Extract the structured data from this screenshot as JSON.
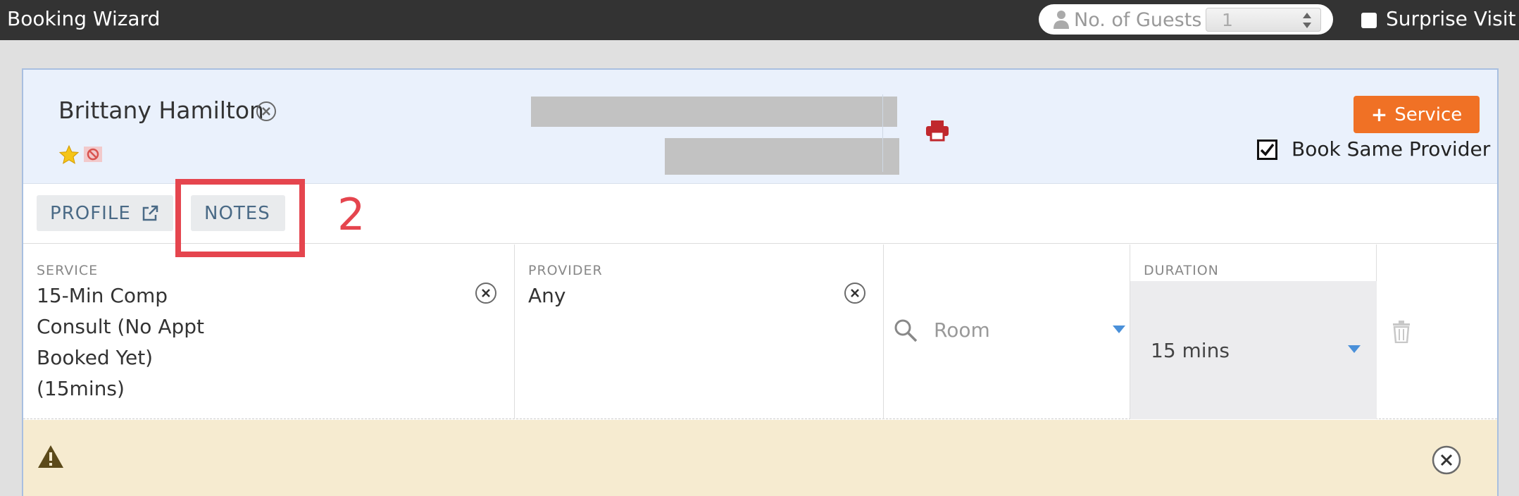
{
  "app": {
    "title": "Booking Wizard"
  },
  "topbar": {
    "guests_label": "No. of Guests",
    "guests_value": "1",
    "surprise_label": "Surprise Visit",
    "surprise_checked": false
  },
  "client": {
    "name": "Brittany Hamilton"
  },
  "actions": {
    "service_button": "Service",
    "book_same_provider": "Book Same Provider",
    "book_same_provider_checked": true
  },
  "tabs": [
    {
      "label": "PROFILE"
    },
    {
      "label": "NOTES"
    }
  ],
  "annotation": {
    "number": "2"
  },
  "service_row": {
    "service_label": "SERVICE",
    "service_lines": [
      "15-Min Comp",
      "Consult (No Appt",
      "Booked Yet)",
      "(15mins)"
    ],
    "provider_label": "PROVIDER",
    "provider_value": "Any",
    "room_placeholder": "Room",
    "duration_label": "DURATION",
    "duration_value": "15 mins"
  },
  "colors": {
    "topbar": "#333333",
    "accent_orange": "#f07125",
    "header_bg": "#eaf1fc",
    "annotation_red": "#e5454e",
    "warning_bg": "#f6ebd0",
    "print_red": "#c0282d"
  },
  "icons": {
    "user": "user-icon",
    "remove": "close-circle-icon",
    "star": "star-icon",
    "no": "no-entry-icon",
    "print": "printer-icon",
    "external": "external-link-icon",
    "search": "search-icon",
    "caret": "caret-down-icon",
    "trash": "trash-icon",
    "warning": "warning-icon"
  }
}
